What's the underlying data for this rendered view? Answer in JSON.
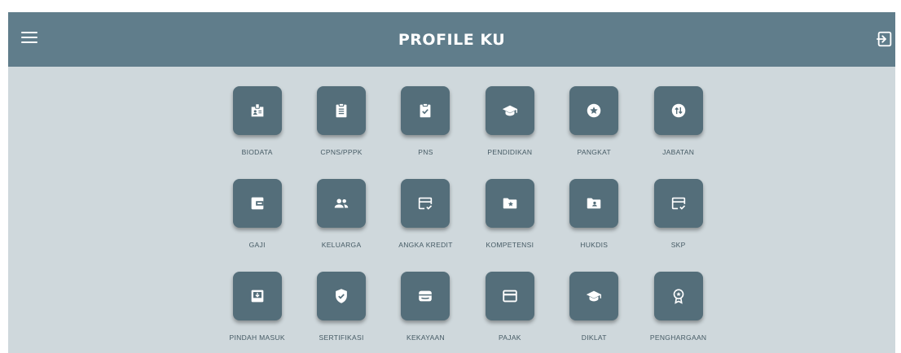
{
  "header": {
    "title": "PROFILE KU"
  },
  "colors": {
    "appbar": "#607d8b",
    "background": "#cfd8dc",
    "tile": "#546e7a"
  },
  "menu": [
    {
      "label": "BIODATA",
      "icon": "badge-icon"
    },
    {
      "label": "CPNS/PPPK",
      "icon": "clipboard-icon"
    },
    {
      "label": "PNS",
      "icon": "clipboard-check-icon"
    },
    {
      "label": "PENDIDIKAN",
      "icon": "graduation-cap-icon"
    },
    {
      "label": "PANGKAT",
      "icon": "star-circle-icon"
    },
    {
      "label": "JABATAN",
      "icon": "swap-circle-icon"
    },
    {
      "label": "GAJI",
      "icon": "wallet-icon"
    },
    {
      "label": "KELUARGA",
      "icon": "people-icon"
    },
    {
      "label": "ANGKA KREDIT",
      "icon": "card-check-icon"
    },
    {
      "label": "KOMPETENSI",
      "icon": "folder-star-icon"
    },
    {
      "label": "HUKDIS",
      "icon": "folder-person-icon"
    },
    {
      "label": "SKP",
      "icon": "card-check-icon"
    },
    {
      "label": "PINDAH MASUK",
      "icon": "move-in-icon"
    },
    {
      "label": "SERTIFIKASI",
      "icon": "shield-check-icon"
    },
    {
      "label": "KEKAYAAN",
      "icon": "wallet-card-icon"
    },
    {
      "label": "PAJAK",
      "icon": "credit-card-icon"
    },
    {
      "label": "DIKLAT",
      "icon": "graduation-cap-icon"
    },
    {
      "label": "PENGHARGAAN",
      "icon": "award-icon"
    }
  ]
}
